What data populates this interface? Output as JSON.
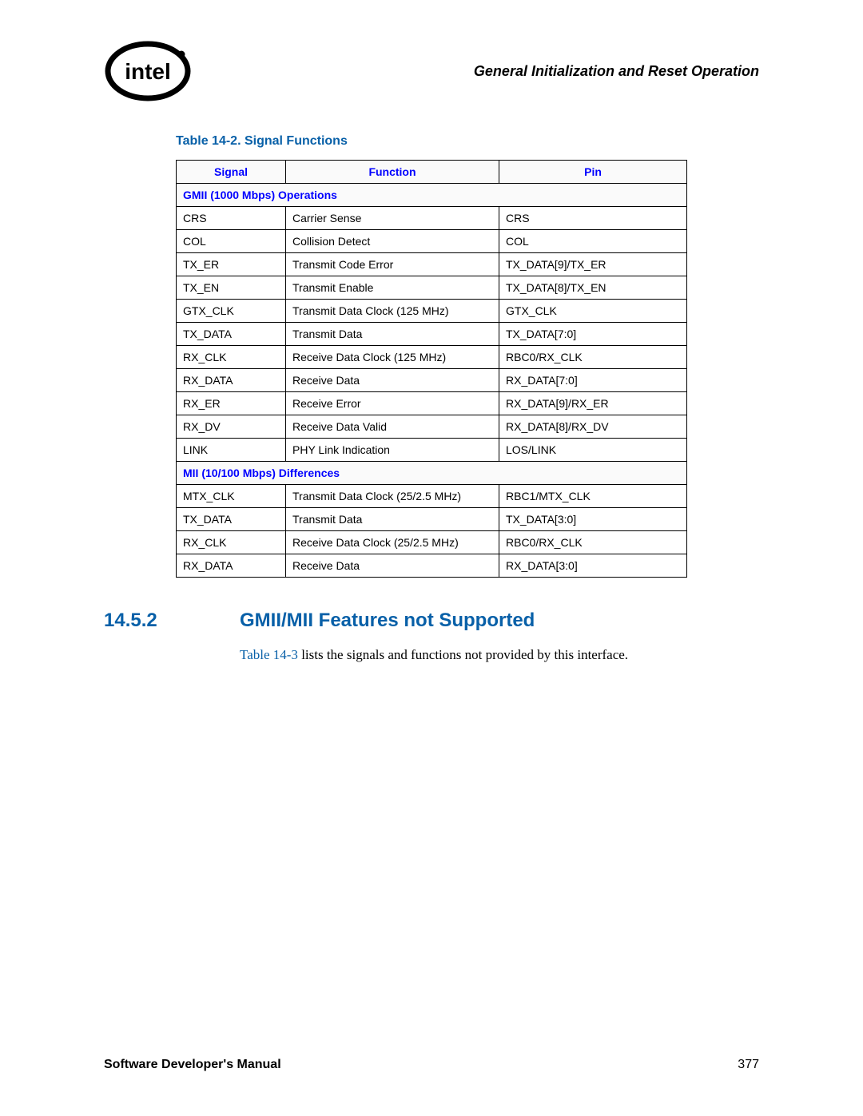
{
  "header": {
    "chapter": "General Initialization and Reset Operation"
  },
  "table": {
    "title": "Table 14-2. Signal Functions",
    "columns": {
      "signal": "Signal",
      "function": "Function",
      "pin": "Pin"
    },
    "section1": {
      "title": "GMII (1000 Mbps) Operations"
    },
    "gmii": [
      {
        "signal": "CRS",
        "function": "Carrier Sense",
        "pin": "CRS"
      },
      {
        "signal": "COL",
        "function": "Collision Detect",
        "pin": "COL"
      },
      {
        "signal": "TX_ER",
        "function": "Transmit Code Error",
        "pin": "TX_DATA[9]/TX_ER"
      },
      {
        "signal": "TX_EN",
        "function": "Transmit Enable",
        "pin": "TX_DATA[8]/TX_EN"
      },
      {
        "signal": "GTX_CLK",
        "function": "Transmit Data Clock (125 MHz)",
        "pin": "GTX_CLK"
      },
      {
        "signal": "TX_DATA",
        "function": "Transmit Data",
        "pin": "TX_DATA[7:0]"
      },
      {
        "signal": "RX_CLK",
        "function": "Receive Data Clock (125 MHz)",
        "pin": "RBC0/RX_CLK"
      },
      {
        "signal": "RX_DATA",
        "function": "Receive Data",
        "pin": "RX_DATA[7:0]"
      },
      {
        "signal": "RX_ER",
        "function": "Receive Error",
        "pin": "RX_DATA[9]/RX_ER"
      },
      {
        "signal": "RX_DV",
        "function": "Receive Data Valid",
        "pin": "RX_DATA[8]/RX_DV"
      },
      {
        "signal": "LINK",
        "function": "PHY Link Indication",
        "pin": "LOS/LINK"
      }
    ],
    "section2": {
      "title": "MII (10/100 Mbps) Differences"
    },
    "mii": [
      {
        "signal": "MTX_CLK",
        "function": "Transmit Data Clock (25/2.5 MHz)",
        "pin": "RBC1/MTX_CLK"
      },
      {
        "signal": "TX_DATA",
        "function": "Transmit Data",
        "pin": "TX_DATA[3:0]"
      },
      {
        "signal": "RX_CLK",
        "function": "Receive Data Clock (25/2.5 MHz)",
        "pin": "RBC0/RX_CLK"
      },
      {
        "signal": "RX_DATA",
        "function": "Receive Data",
        "pin": "RX_DATA[3:0]"
      }
    ]
  },
  "section": {
    "number": "14.5.2",
    "title": "GMII/MII Features not Supported",
    "ref": "Table 14-3",
    "body_rest": " lists the signals and functions not provided by this interface."
  },
  "footer": {
    "left": "Software Developer's Manual",
    "right": "377"
  }
}
